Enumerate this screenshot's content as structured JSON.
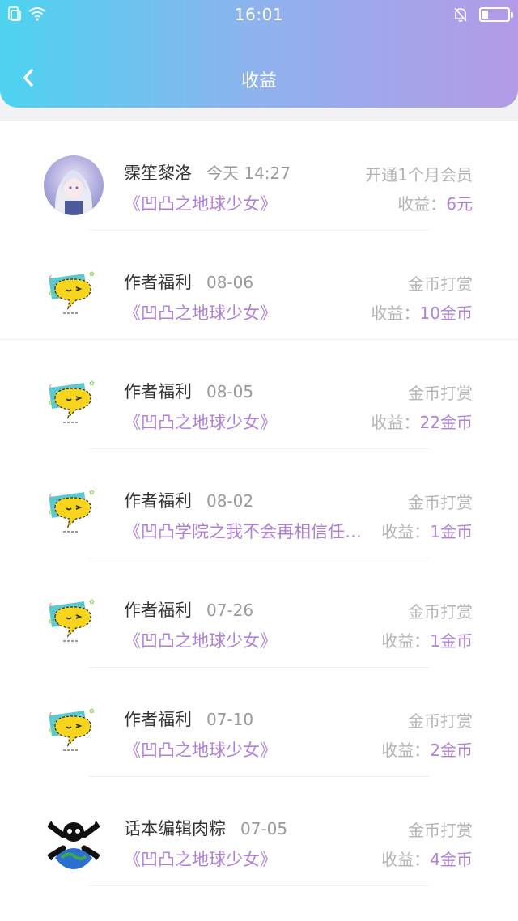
{
  "status_bar": {
    "time": "16:01"
  },
  "header": {
    "title": "收益"
  },
  "earnings_label": "收益：",
  "items": [
    {
      "name": "霂笙黎洛",
      "time": "今天 14:27",
      "work": "《凹凸之地球少女》",
      "type": "开通1个月会员",
      "amount": "6元",
      "avatar": "anime-girl-avatar"
    },
    {
      "name": "作者福利",
      "time": "08-06",
      "work": "《凹凸之地球少女》",
      "type": "金币打赏",
      "amount": "10金币",
      "avatar": "yellow-chat-bubble-avatar"
    },
    {
      "name": "作者福利",
      "time": "08-05",
      "work": "《凹凸之地球少女》",
      "type": "金币打赏",
      "amount": "22金币",
      "avatar": "yellow-chat-bubble-avatar"
    },
    {
      "name": "作者福利",
      "time": "08-02",
      "work": "《凹凸学院之我不会再相信任…",
      "type": "金币打赏",
      "amount": "1金币",
      "avatar": "yellow-chat-bubble-avatar"
    },
    {
      "name": "作者福利",
      "time": "07-26",
      "work": "《凹凸之地球少女》",
      "type": "金币打赏",
      "amount": "1金币",
      "avatar": "yellow-chat-bubble-avatar"
    },
    {
      "name": "作者福利",
      "time": "07-10",
      "work": "《凹凸之地球少女》",
      "type": "金币打赏",
      "amount": "2金币",
      "avatar": "yellow-chat-bubble-avatar"
    },
    {
      "name": "话本编辑肉粽",
      "time": "07-05",
      "work": "《凹凸之地球少女》",
      "type": "金币打赏",
      "amount": "4金币",
      "avatar": "earth-skull-avatar"
    }
  ]
}
